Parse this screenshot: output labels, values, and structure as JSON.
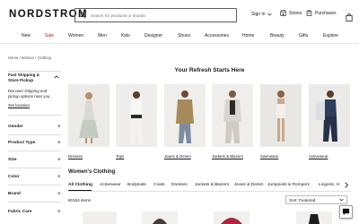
{
  "header": {
    "logo": "NORDSTROM",
    "search_placeholder": "Search for products or brands",
    "sign_in": "Sign In",
    "stores": "Stores",
    "purchases": "Purchases"
  },
  "nav": {
    "items": [
      "New",
      "Sale",
      "Women",
      "Men",
      "Kids",
      "Designer",
      "Shoes",
      "Accessories",
      "Home",
      "Beauty",
      "Gifts",
      "Explore"
    ],
    "sale_color": "#b4202d"
  },
  "breadcrumb": "Home  /  Women  /  Clothing",
  "sidebar": {
    "shipping_title": "Fast Shipping & Store Pickup",
    "shipping_desc": "Discover shipping and pickup options near you.",
    "set_location": "Set location",
    "filters": [
      "Gender",
      "Product Type",
      "Size",
      "Color",
      "Brand",
      "Fabric Care"
    ]
  },
  "refresh": {
    "title": "Your Refresh Starts Here",
    "cards": [
      {
        "label": "Dresses",
        "icon": "dress-photo"
      },
      {
        "label": "Tops",
        "icon": "tops-photo"
      },
      {
        "label": "Jeans & Denim",
        "icon": "denim-photo"
      },
      {
        "label": "Jackets & Blazers",
        "icon": "jacket-photo"
      },
      {
        "label": "Swimwear",
        "icon": "swimwear-photo"
      },
      {
        "label": "Activewear",
        "icon": "activewear-photo"
      }
    ]
  },
  "listing": {
    "title": "Women's Clothing",
    "tabs": [
      "All Clothing",
      "Activewear",
      "Bodysuits",
      "Coats",
      "Dresses",
      "Jackets & Blazers",
      "Jeans & Denim",
      "Jumpsuits & Rompers",
      "Lingerie, H"
    ],
    "count": "80154 items",
    "sort": "Sort: Featured"
  }
}
